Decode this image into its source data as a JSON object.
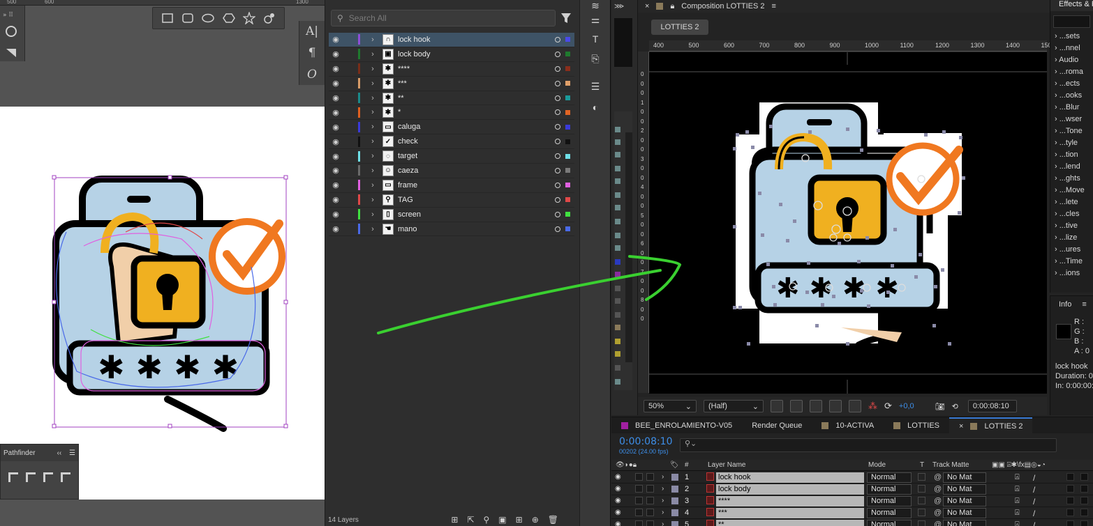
{
  "illustrator": {
    "ruler_ticks": [
      "500",
      "600",
      "1300"
    ],
    "type_tools": [
      "A|",
      "¶",
      "O"
    ],
    "shape_tools": [
      "rectangle-icon",
      "rounded-rect-icon",
      "ellipse-icon",
      "polygon-icon",
      "star-icon",
      "flare-icon"
    ],
    "pathfinder": {
      "title": "Pathfinder",
      "collapse": "‹‹",
      "menu": "☰"
    }
  },
  "layers": {
    "search_placeholder": "Search All",
    "footer_count": "14 Layers",
    "items": [
      {
        "name": "lock hook",
        "color": "#8e4fd8",
        "sq": "#4a4ae8",
        "thumb": "∩",
        "selected": true
      },
      {
        "name": "lock body",
        "color": "#1f7a2e",
        "sq": "#1f7a2e",
        "thumb": "▣",
        "selected": false
      },
      {
        "name": "****",
        "color": "#7a2d18",
        "sq": "#8a2e1c",
        "thumb": "✱",
        "selected": false
      },
      {
        "name": "***",
        "color": "#d79b68",
        "sq": "#e0a06a",
        "thumb": "✱",
        "selected": false
      },
      {
        "name": "**",
        "color": "#1a8a8a",
        "sq": "#1a9a9a",
        "thumb": "✱",
        "selected": false
      },
      {
        "name": "*",
        "color": "#e06020",
        "sq": "#e06424",
        "thumb": "✱",
        "selected": false
      },
      {
        "name": "caluga",
        "color": "#3a3ad8",
        "sq": "#3a3ad8",
        "thumb": "▭",
        "selected": false
      },
      {
        "name": "check",
        "color": "#111111",
        "sq": "#111111",
        "thumb": "✓",
        "selected": false
      },
      {
        "name": "target",
        "color": "#6fe0e8",
        "sq": "#6fe0e8",
        "thumb": "◌",
        "selected": false
      },
      {
        "name": "caeza",
        "color": "#6a6a6a",
        "sq": "#7a7a7a",
        "thumb": "☺",
        "selected": false
      },
      {
        "name": "frame",
        "color": "#e060e0",
        "sq": "#e060e0",
        "thumb": "▭",
        "selected": false
      },
      {
        "name": "TAG",
        "color": "#e04848",
        "sq": "#e04848",
        "thumb": "⚲",
        "selected": false
      },
      {
        "name": "screen",
        "color": "#40e040",
        "sq": "#40e040",
        "thumb": "▯",
        "selected": false
      },
      {
        "name": "mano",
        "color": "#4a6ae8",
        "sq": "#4a6ae8",
        "thumb": "☚",
        "selected": false
      }
    ]
  },
  "after_effects": {
    "comp_header": "Composition LOTTIES 2",
    "comp_tab": "LOTTIES 2",
    "ruler_h": [
      "400",
      "500",
      "600",
      "700",
      "800",
      "900",
      "1000",
      "1100",
      "1200",
      "1300",
      "1400",
      "150"
    ],
    "ruler_v": [
      "0",
      "0",
      "0",
      "1",
      "0",
      "0",
      "2",
      "0",
      "0",
      "3",
      "0",
      "0",
      "4",
      "0",
      "0",
      "5",
      "0",
      "0",
      "6",
      "0",
      "0",
      "7",
      "0",
      "0",
      "8",
      "0",
      "0"
    ],
    "viewer": {
      "zoom": "50%",
      "resolution": "(Half)",
      "exposure": "+0,0",
      "timecode": "0:00:08:10"
    },
    "effects": {
      "title": "Effects & P",
      "items": [
        "...sets",
        "...nnel",
        "Audio",
        "...roma",
        "...ects",
        "...ooks",
        "...Blur",
        "...wser",
        "...Tone",
        "...tyle",
        "...tion",
        "...lend",
        "...ghts",
        "...Move",
        "...lete",
        "...cles",
        "...tive",
        "...lize",
        "...ures",
        "...Time",
        "...ions"
      ]
    },
    "info": {
      "title": "Info",
      "r": "R :",
      "g": "G :",
      "b": "B :",
      "a": "A : 0",
      "layer": "lock hook",
      "duration": "Duration: 0",
      "in": "In: 0:00:00:"
    },
    "timeline": {
      "tabs": [
        {
          "label": "BEE_ENROLAMIENTO-V05",
          "color": "#a020a0",
          "active": false
        },
        {
          "label": "Render Queue",
          "color": "",
          "active": false
        },
        {
          "label": "10-ACTIVA",
          "color": "#8a7a5a",
          "active": false
        },
        {
          "label": "LOTTIES",
          "color": "#8a7a5a",
          "active": false
        },
        {
          "label": "LOTTIES 2",
          "color": "#8a7a5a",
          "active": true
        }
      ],
      "time": "0:00:08:10",
      "fps": "00202 (24.00 fps)",
      "search_placeholder": "⚲⌄",
      "headers": {
        "num": "#",
        "name": "Layer Name",
        "mode": "Mode",
        "t": "T",
        "matte": "Track Matte"
      },
      "rows": [
        {
          "num": "1",
          "name": "lock hook",
          "mode": "Normal",
          "matte": "No Mat"
        },
        {
          "num": "2",
          "name": "lock body",
          "mode": "Normal",
          "matte": "No Mat"
        },
        {
          "num": "3",
          "name": "****",
          "mode": "Normal",
          "matte": "No Mat"
        },
        {
          "num": "4",
          "name": "***",
          "mode": "Normal",
          "matte": "No Mat"
        },
        {
          "num": "5",
          "name": "**",
          "mode": "Normal",
          "matte": "No Mat"
        }
      ]
    }
  }
}
